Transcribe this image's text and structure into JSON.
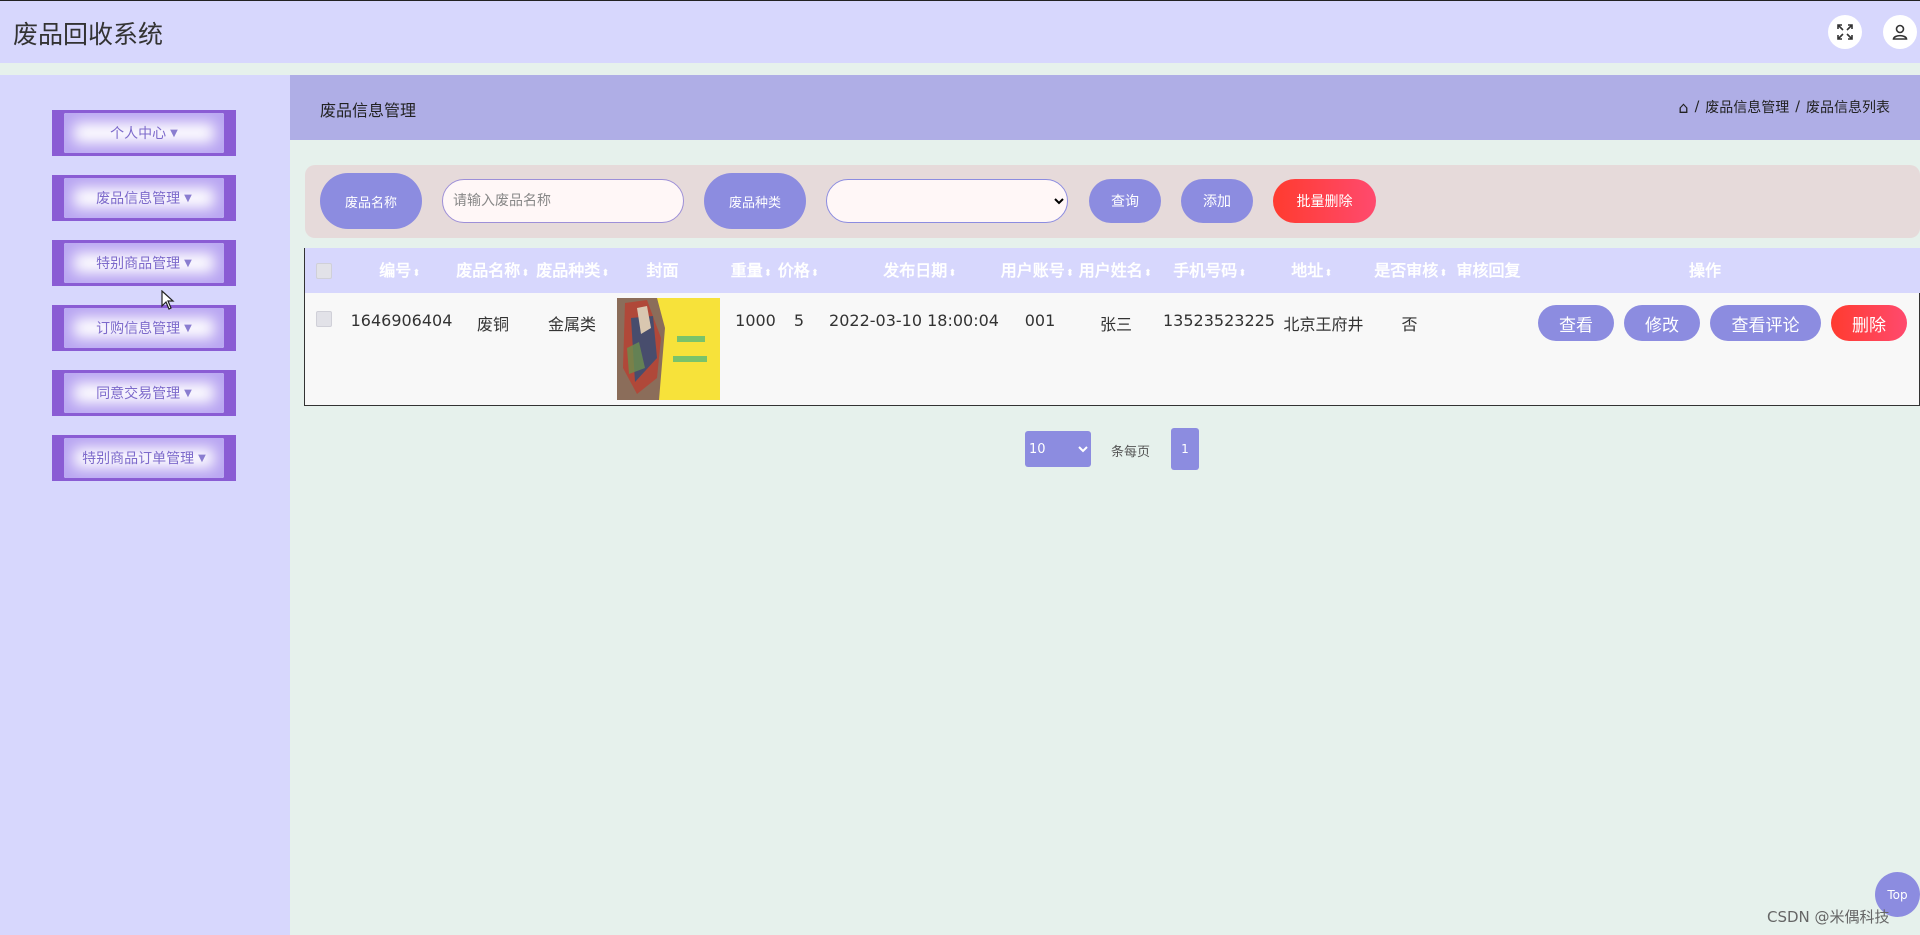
{
  "header": {
    "app_title": "废品回收系统",
    "icons": [
      "fullscreen-icon",
      "user-icon"
    ]
  },
  "sidebar": {
    "items": [
      {
        "label": "个人中心"
      },
      {
        "label": "废品信息管理"
      },
      {
        "label": "特别商品管理"
      },
      {
        "label": "订购信息管理"
      },
      {
        "label": "同意交易管理"
      },
      {
        "label": "特别商品订单管理"
      }
    ]
  },
  "content": {
    "title": "废品信息管理",
    "breadcrumb": [
      "废品信息管理",
      "废品信息列表"
    ]
  },
  "search": {
    "name_label": "废品名称",
    "name_placeholder": "请输入废品名称",
    "name_value": "",
    "type_label": "废品种类",
    "type_selected": "",
    "query_button": "查询",
    "add_button": "添加",
    "batch_delete_button": "批量删除"
  },
  "table": {
    "columns": [
      "编号",
      "废品名称",
      "废品种类",
      "封面",
      "重量",
      "价格",
      "发布日期",
      "用户账号",
      "用户姓名",
      "手机号码",
      "地址",
      "是否审核",
      "审核回复",
      "操作"
    ],
    "rows": [
      {
        "id": "1646906404",
        "name": "废铜",
        "type": "金属类",
        "weight": "1000",
        "price": "5",
        "date": "2022-03-10 18:00:04",
        "account": "001",
        "user_name": "张三",
        "phone": "13523523225",
        "address": "北京王府井",
        "approved": "否",
        "reply": ""
      }
    ],
    "row_actions": {
      "view": "查看",
      "edit": "修改",
      "comments": "查看评论",
      "delete": "删除"
    }
  },
  "pagination": {
    "page_size": "10",
    "page_size_options": [
      "10"
    ],
    "per_page_text": "条每页",
    "current_page": "1"
  },
  "floating": {
    "top_button": "Top"
  },
  "watermark": "CSDN @米偶科技",
  "colors": {
    "header_bg": "#d7d7fd",
    "accent": "#8c8ce0",
    "danger": "#ff4a4a",
    "sidebar_item": "#8a5cd4"
  }
}
